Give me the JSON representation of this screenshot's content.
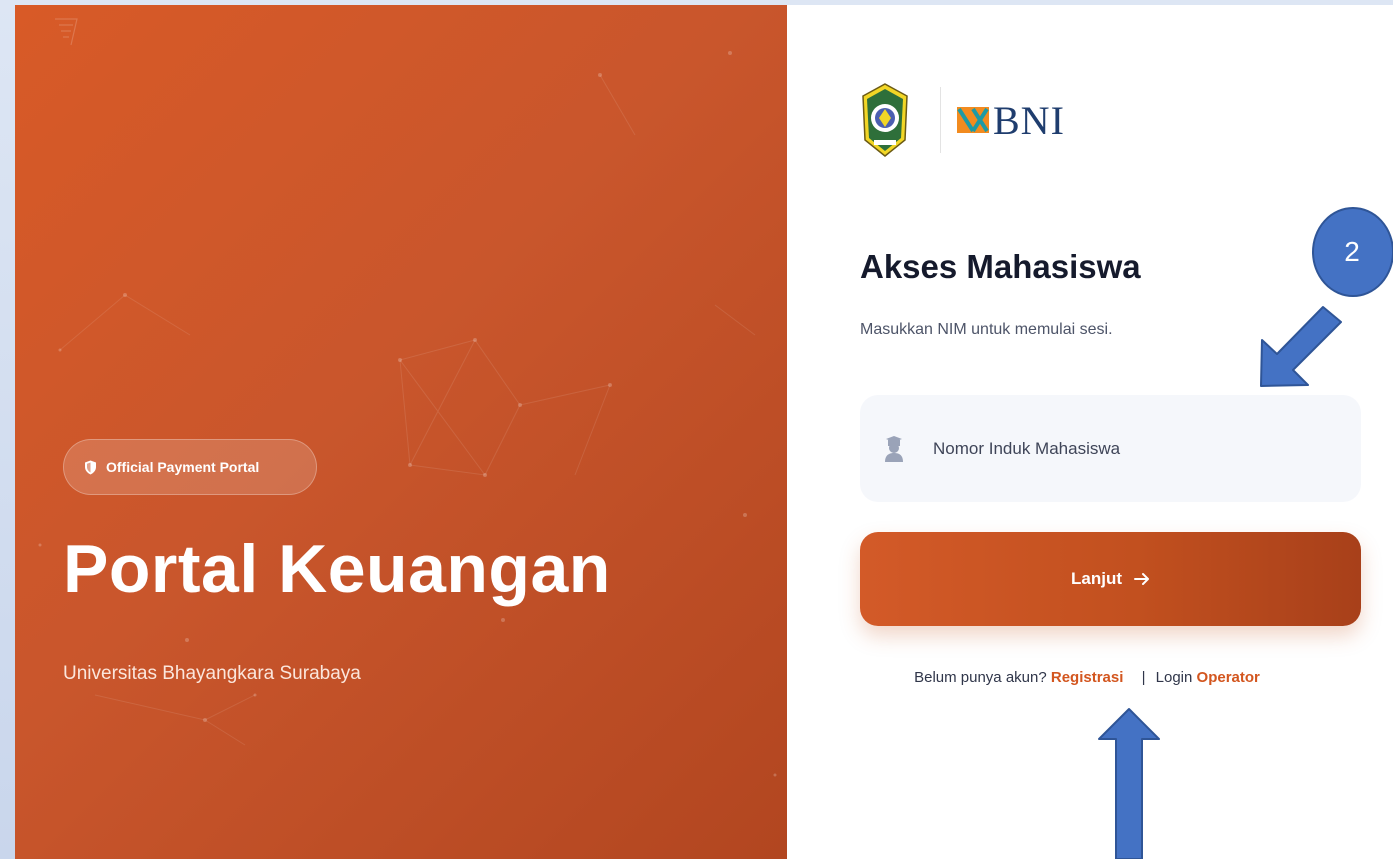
{
  "hero": {
    "badge_label": "Official Payment Portal",
    "badge_icon": "shield-icon",
    "title": "Portal Keuangan",
    "subtitle": "Universitas Bhayangkara Surabaya"
  },
  "logos": {
    "university": "university-seal-logo",
    "bank_text": "BNI"
  },
  "login": {
    "title": "Akses Mahasiswa",
    "subtitle": "Masukkan NIM untuk memulai sesi.",
    "nim_placeholder": "Nomor Induk Mahasiswa",
    "nim_value": "",
    "submit_label": "Lanjut",
    "submit_icon": "arrow-right-icon",
    "no_account_text": "Belum punya akun?",
    "register_link": "Registrasi",
    "separator": "|",
    "login_prefix": "Login",
    "operator_link": "Operator"
  },
  "annotations": {
    "step_number": "2",
    "color": "#4472c4"
  },
  "colors": {
    "brand_orange": "#d3561f",
    "hero_gradient_start": "#d85a27",
    "hero_gradient_end": "#b24620",
    "title_text": "#151a2c"
  }
}
